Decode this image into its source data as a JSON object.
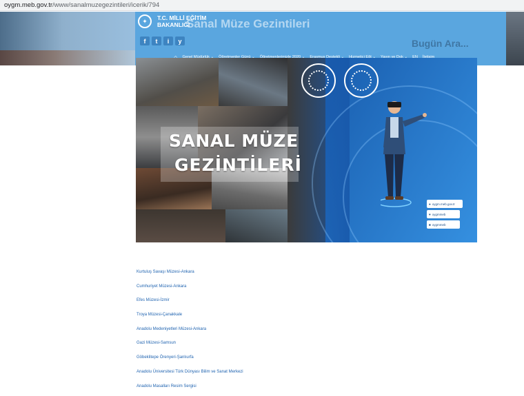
{
  "address_bar": {
    "host": "oygm.meb.gov.tr",
    "path": "/www/sanalmuzegezintileri/icerik/794"
  },
  "header": {
    "ministry_line1": "T.C. MİLLİ EĞİTİM",
    "ministry_line2": "BAKANLIĞI",
    "site_title": "Sanal Müze Gezintileri",
    "ghost_text": "Bugün Ara...",
    "social_icons": [
      "f",
      "t",
      "i",
      "y"
    ],
    "nav": [
      "Genel Müdürlük ⌄",
      "Öğretmenler Günü ⌄",
      "Öğretmenlerimizle 2020 ⌄",
      "Erasmus Destekli ⌄",
      "Hizmetiçi Eğt ⌄",
      "Yayın ve Dok ⌄",
      "EN",
      "İletişim"
    ]
  },
  "banner": {
    "title_line1": "SANAL MÜZE",
    "title_line2": "GEZİNTİLERİ",
    "contacts": [
      {
        "icon": "globe-icon",
        "text": "oygm.meb.gov.tr"
      },
      {
        "icon": "twitter-icon",
        "text": "oygmmeb"
      },
      {
        "icon": "camera-icon",
        "text": "oygmmeb"
      }
    ],
    "colors": {
      "background": "#2a78c4",
      "accent": "#5aa6df"
    }
  },
  "museum_links": [
    "Kurtuluş Savaşı Müzesi-Ankara",
    "Cumhuriyet Müzesi-Ankara",
    "Efes Müzesi-İzmir",
    "Troya Müzesi-Çanakkale",
    "Anadolu Medeniyetleri Müzesi-Ankara",
    "Gazi Müzesi-Samsun",
    "Göbeklitepe Örenyeri-Şanlıurfa",
    "Anadolu Üniversitesi Türk Dünyası Bilim ve Sanat Merkezi",
    "Anadolu Masalları Resim Sergisi"
  ]
}
